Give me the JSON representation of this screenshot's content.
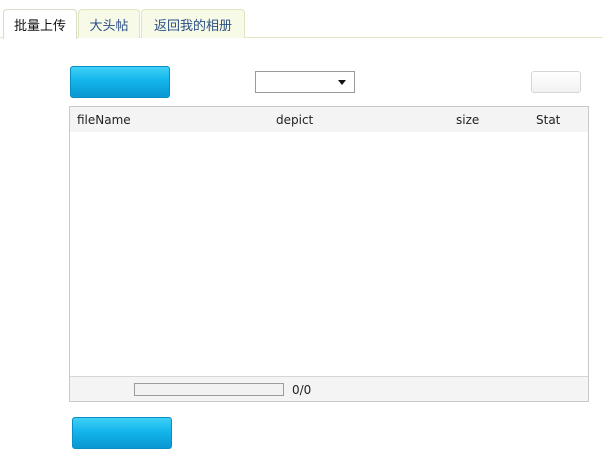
{
  "tabs": [
    {
      "label": "批量上传",
      "active": true
    },
    {
      "label": "大头帖",
      "active": false
    },
    {
      "label": "返回我的相册",
      "active": false
    }
  ],
  "toolbar": {
    "select_value": "",
    "gray_button_label": ""
  },
  "upload_list": {
    "columns": [
      "fileName",
      "depict",
      "size",
      "Stat"
    ],
    "rows": [],
    "progress": {
      "fraction": 0,
      "text": "0/0"
    }
  },
  "colors": {
    "blue_button": "#13b5eb",
    "tab_inactive_text": "#2a4f86"
  }
}
